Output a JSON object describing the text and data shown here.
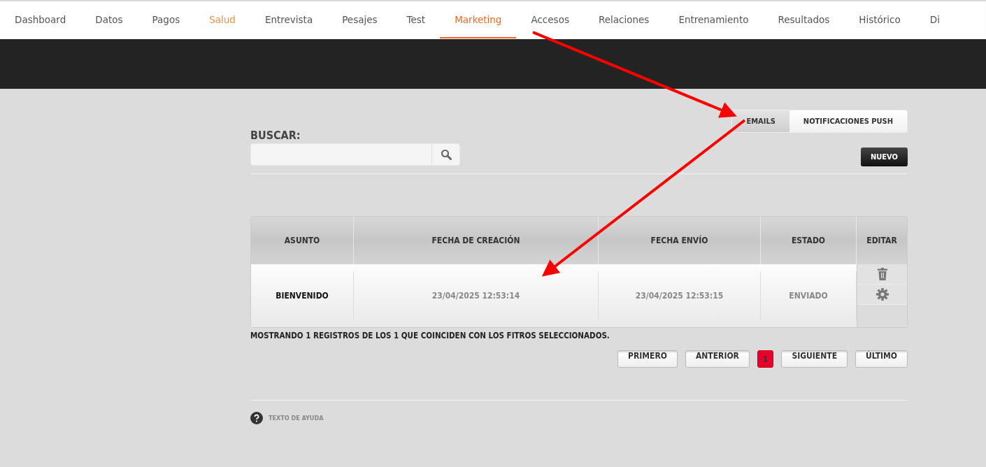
{
  "nav": {
    "tabs": [
      {
        "label": "Dashboard",
        "selected": false,
        "highlighted": false
      },
      {
        "label": "Datos",
        "selected": false,
        "highlighted": false
      },
      {
        "label": "Pagos",
        "selected": false,
        "highlighted": false
      },
      {
        "label": "Salud",
        "selected": false,
        "highlighted": true
      },
      {
        "label": "Entrevista",
        "selected": false,
        "highlighted": false
      },
      {
        "label": "Pesajes",
        "selected": false,
        "highlighted": false
      },
      {
        "label": "Test",
        "selected": false,
        "highlighted": false
      },
      {
        "label": "Marketing",
        "selected": true,
        "highlighted": false
      },
      {
        "label": "Accesos",
        "selected": false,
        "highlighted": false
      },
      {
        "label": "Relaciones",
        "selected": false,
        "highlighted": false
      },
      {
        "label": "Entrenamiento",
        "selected": false,
        "highlighted": false
      },
      {
        "label": "Resultados",
        "selected": false,
        "highlighted": false
      },
      {
        "label": "Histórico",
        "selected": false,
        "highlighted": false
      },
      {
        "label": "Di",
        "selected": false,
        "highlighted": false
      }
    ]
  },
  "search": {
    "label": "BUSCAR:"
  },
  "channel_tabs": [
    {
      "label": "EMAILS",
      "selected": true
    },
    {
      "label": "NOTIFICACIONES PUSH",
      "selected": false
    }
  ],
  "new_button": "NUEVO",
  "table": {
    "columns": [
      "ASUNTO",
      "FECHA DE CREACIÓN",
      "FECHA ENVÍO",
      "ESTADO",
      "EDITAR"
    ],
    "rows": [
      {
        "asunto": "BIENVENIDO",
        "created": "23/04/2025 12:53:14",
        "sent": "23/04/2025 12:53:15",
        "status": "ENVIADO"
      }
    ]
  },
  "summary": "MOSTRANDO 1 REGISTROS DE LOS 1 QUE COINCIDEN CON LOS FITROS SELECCIONADOS.",
  "pagination": [
    {
      "label": "PRIMERO",
      "kind": "nav",
      "selected": false
    },
    {
      "label": "ANTERIOR",
      "kind": "nav",
      "selected": false
    },
    {
      "label": "1",
      "kind": "page",
      "selected": true
    },
    {
      "label": "SIGUIENTE",
      "kind": "nav",
      "selected": false
    },
    {
      "label": "ÚLTIMO",
      "kind": "nav",
      "selected": false
    }
  ],
  "help": "TEXTO DE AYUDA"
}
